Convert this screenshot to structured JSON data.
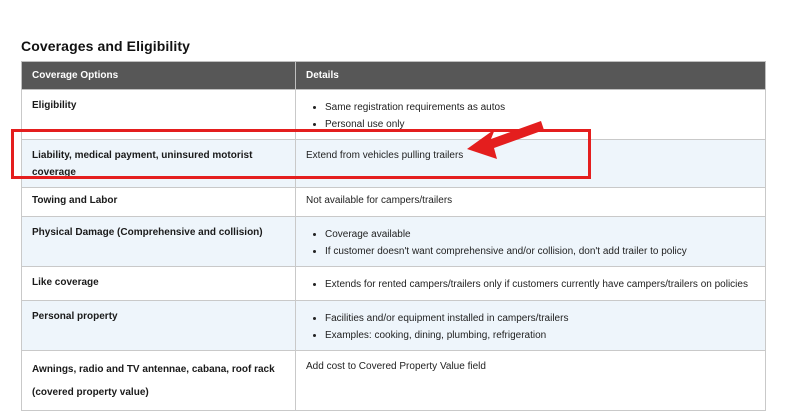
{
  "heading": "Coverages and Eligibility",
  "table": {
    "headers": [
      "Coverage Options",
      "Details"
    ],
    "rows": [
      {
        "option": "Eligibility",
        "details_bullets": [
          "Same registration requirements as autos",
          "Personal use only"
        ]
      },
      {
        "option": "Liability, medical payment, uninsured motorist coverage",
        "details_text": "Extend from vehicles pulling trailers"
      },
      {
        "option": "Towing and Labor",
        "details_text": "Not available for campers/trailers"
      },
      {
        "option": "Physical Damage (Comprehensive and collision)",
        "details_bullets": [
          "Coverage available",
          "If customer doesn't want comprehensive and/or collision, don't add trailer to policy"
        ]
      },
      {
        "option": "Like coverage",
        "details_bullets": [
          "Extends for rented campers/trailers only if customers currently have campers/trailers on policies"
        ]
      },
      {
        "option": "Personal property",
        "details_bullets": [
          "Facilities and/or equipment installed in campers/trailers",
          "Examples: cooking, dining, plumbing, refrigeration"
        ]
      },
      {
        "option_lines": [
          "Awnings, radio and TV antennae, cabana, roof rack",
          "(covered property value)"
        ],
        "details_text": "Add cost to Covered Property Value field"
      }
    ]
  },
  "annotation": {
    "color": "#e41e1e",
    "highlight_icon": "highlight-box",
    "pointer_icon": "red-arrow-icon"
  },
  "colors": {
    "header_bg": "#575757",
    "alt_row_bg": "#eef5fb",
    "border": "#c9c9c9"
  }
}
